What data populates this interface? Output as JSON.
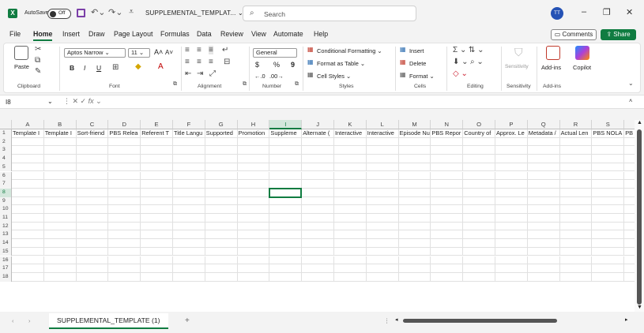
{
  "titlebar": {
    "autosave_label": "AutoSave",
    "autosave_state": "Off",
    "doc_title": "SUPPLEMENTAL_TEMPLAT... ⌄",
    "search_placeholder": "Search",
    "avatar_initials": "TT",
    "minimize": "–",
    "restore": "❐",
    "close": "✕"
  },
  "menu": {
    "tabs": [
      "File",
      "Home",
      "Insert",
      "Draw",
      "Page Layout",
      "Formulas",
      "Data",
      "Review",
      "View",
      "Automate",
      "Help"
    ],
    "comments": "Comments",
    "share": "Share"
  },
  "ribbon": {
    "clipboard": {
      "paste": "Paste",
      "label": "Clipboard"
    },
    "font": {
      "name": "Aptos Narrow",
      "size": "11",
      "label": "Font",
      "bold": "B",
      "italic": "I",
      "underline": "U"
    },
    "alignment": {
      "label": "Alignment"
    },
    "number": {
      "format": "General",
      "currency": "$",
      "percent": "%",
      "comma": "9",
      "label": "Number"
    },
    "styles": {
      "conditional": "Conditional Formatting ⌄",
      "table": "Format as Table ⌄",
      "cell_styles": "Cell Styles ⌄",
      "label": "Styles"
    },
    "cells": {
      "insert": "Insert",
      "delete": "Delete",
      "format": "Format ⌄",
      "label": "Cells"
    },
    "editing": {
      "label": "Editing"
    },
    "sensitivity": {
      "button": "Sensitivity",
      "label": "Sensitivity"
    },
    "addins": {
      "button": "Add-ins",
      "label": "Add-ins"
    },
    "copilot": {
      "button": "Copilot"
    }
  },
  "formula_bar": {
    "name_box": "I8",
    "fx": "fx",
    "value": ""
  },
  "columns": [
    "A",
    "B",
    "C",
    "D",
    "E",
    "F",
    "G",
    "H",
    "I",
    "J",
    "K",
    "L",
    "M",
    "N",
    "O",
    "P",
    "Q",
    "R",
    "S"
  ],
  "rows": [
    "1",
    "2",
    "3",
    "4",
    "5",
    "6",
    "7",
    "8",
    "9",
    "10",
    "11",
    "12",
    "13",
    "14",
    "15",
    "16",
    "17",
    "18"
  ],
  "selected": {
    "column": "I",
    "row": "8"
  },
  "header_row": [
    "Template I",
    "Template I",
    "Sort-friend",
    "PBS Relea",
    "Referent T",
    "Title Langu",
    "Supported",
    "Promotion",
    "Suppleme",
    "Alternate (",
    "Interactive",
    "Interactive",
    "Episode Nu",
    "PBS Repor",
    "Country of",
    "Approx. Le",
    "Metadata /",
    "Actual Len",
    "PBS NOLA",
    "PB"
  ],
  "sheet_tab": "SUPPLEMENTAL_TEMPLATE (1)",
  "add_sheet": "+"
}
